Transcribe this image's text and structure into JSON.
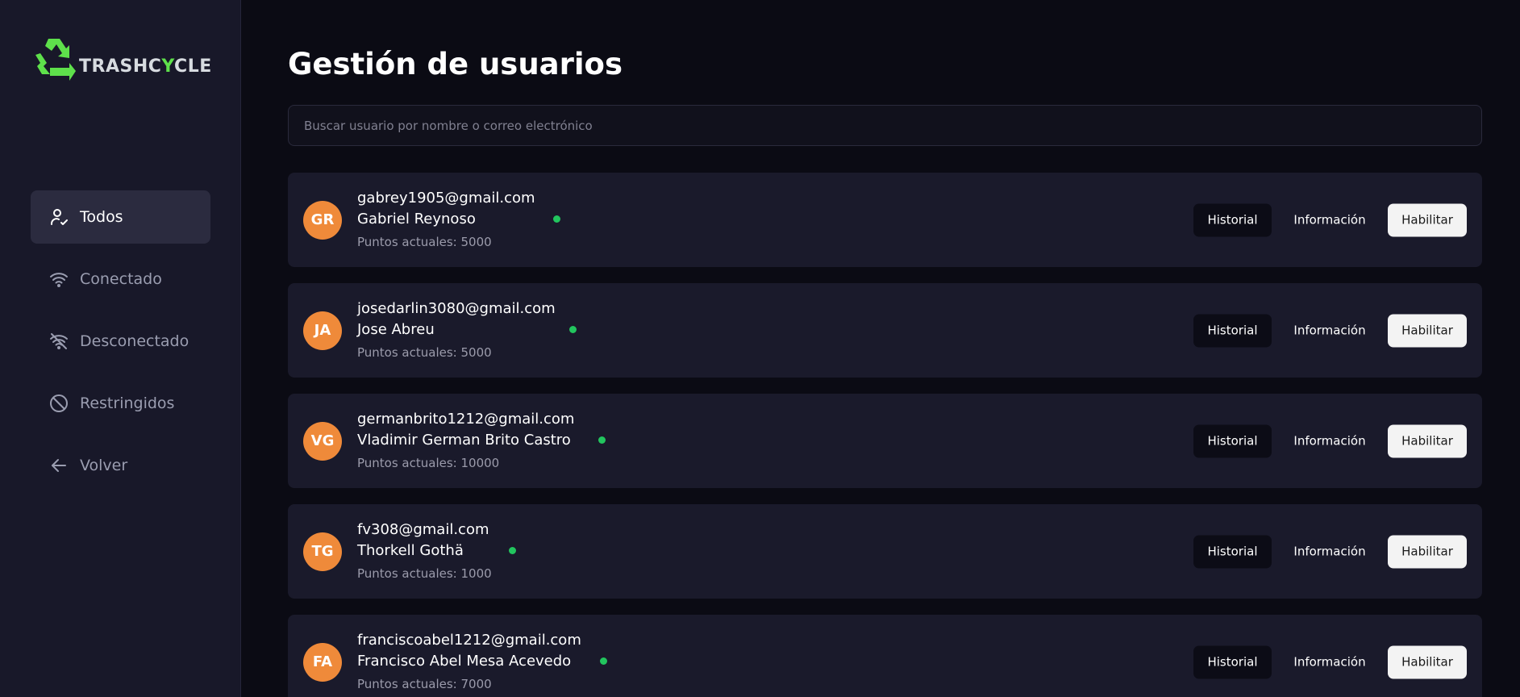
{
  "brand": {
    "name_prefix": "TRASHC",
    "name_accent": "Y",
    "name_suffix": "CLE",
    "logo_icon": "recycle-icon",
    "accent_color": "#5ee04b"
  },
  "sidebar": {
    "items": [
      {
        "label": "Todos",
        "icon": "user-check-icon",
        "active": true
      },
      {
        "label": "Conectado",
        "icon": "wifi-icon",
        "active": false
      },
      {
        "label": "Desconectado",
        "icon": "wifi-off-icon",
        "active": false
      },
      {
        "label": "Restringidos",
        "icon": "ban-icon",
        "active": false
      },
      {
        "label": "Volver",
        "icon": "arrow-left-icon",
        "active": false
      }
    ]
  },
  "main": {
    "title": "Gestión de usuarios",
    "search": {
      "placeholder": "Buscar usuario por nombre o correo electrónico",
      "value": ""
    },
    "buttons": {
      "historial": "Historial",
      "informacion": "Información",
      "habilitar": "Habilitar"
    },
    "users": [
      {
        "initials": "GR",
        "email": "gabrey1905@gmail.com",
        "name": "Gabriel Reynoso",
        "points": "Puntos actuales: 5000",
        "online": true
      },
      {
        "initials": "JA",
        "email": "josedarlin3080@gmail.com",
        "name": "Jose Abreu",
        "points": "Puntos actuales: 5000",
        "online": true
      },
      {
        "initials": "VG",
        "email": "germanbrito1212@gmail.com",
        "name": "Vladimir German Brito Castro",
        "points": "Puntos actuales: 10000",
        "online": true
      },
      {
        "initials": "TG",
        "email": "fv308@gmail.com",
        "name": "Thorkell Gothä",
        "points": "Puntos actuales: 1000",
        "online": true
      },
      {
        "initials": "FA",
        "email": "franciscoabel1212@gmail.com",
        "name": "Francisco Abel Mesa Acevedo",
        "points": "Puntos actuales: 7000",
        "online": true
      }
    ]
  },
  "colors": {
    "background": "#0b0b14",
    "sidebar": "#181829",
    "card": "#1a1a2b",
    "avatar": "#ef8a3a",
    "online": "#22c55e"
  }
}
